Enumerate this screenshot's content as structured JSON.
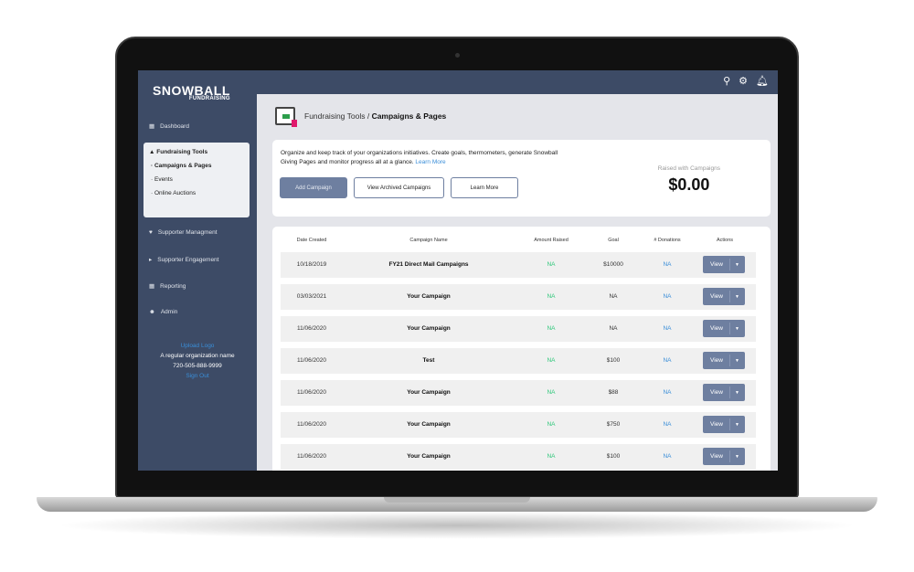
{
  "brand": {
    "name": "SNOWBALL",
    "tagline": "FUNDRAISING"
  },
  "topbar": {
    "icons": [
      "search-icon",
      "gear-icon",
      "bell-icon"
    ]
  },
  "sidebar": {
    "items": [
      {
        "label": "Dashboard",
        "icon": "dashboard-icon"
      },
      {
        "label": "Fundraising Tools",
        "icon": "bank-icon"
      },
      {
        "label": "Supporter Managment",
        "icon": "hand-icon"
      },
      {
        "label": "Supporter Engagement",
        "icon": "megaphone-icon"
      },
      {
        "label": "Reporting",
        "icon": "table-icon"
      },
      {
        "label": "Admin",
        "icon": "user-icon"
      }
    ],
    "subitems": [
      "Campaigns & Pages",
      "Events",
      "Online Auctions"
    ],
    "upload_logo": "Upload Logo",
    "org_name": "A regular organization name",
    "phone": "720-505-888-9999",
    "sign_out": "Sign Out"
  },
  "breadcrumb": {
    "parent": "Fundraising Tools /",
    "current": "Campaigns & Pages"
  },
  "intro": {
    "text": "Organize and keep track of your organizations initiatives. Create goals, thermometers, generate Snowball Giving Pages and monitor progress all at a glance.",
    "learn_more_link": "Learn More",
    "buttons": {
      "add": "Add Campaign",
      "archived": "View Archived Campaigns",
      "learn": "Learn More"
    },
    "raised_label": "Raised with Campaigns",
    "raised_amount": "$0.00"
  },
  "table": {
    "headers": [
      "Date Created",
      "Campaign Name",
      "Amount Raised",
      "Goal",
      "# Donations",
      "Actions"
    ],
    "rows": [
      {
        "date": "10/18/2019",
        "name": "FY21 Direct Mail Campaigns",
        "raised": "NA",
        "goal": "$10000",
        "donations": "NA"
      },
      {
        "date": "03/03/2021",
        "name": "Your Campaign",
        "raised": "NA",
        "goal": "NA",
        "donations": "NA"
      },
      {
        "date": "11/06/2020",
        "name": "Your Campaign",
        "raised": "NA",
        "goal": "NA",
        "donations": "NA"
      },
      {
        "date": "11/06/2020",
        "name": "Test",
        "raised": "NA",
        "goal": "$100",
        "donations": "NA"
      },
      {
        "date": "11/06/2020",
        "name": "Your Campaign",
        "raised": "NA",
        "goal": "$88",
        "donations": "NA"
      },
      {
        "date": "11/06/2020",
        "name": "Your Campaign",
        "raised": "NA",
        "goal": "$750",
        "donations": "NA"
      },
      {
        "date": "11/06/2020",
        "name": "Your Campaign",
        "raised": "NA",
        "goal": "$100",
        "donations": "NA"
      }
    ],
    "view_label": "View"
  }
}
